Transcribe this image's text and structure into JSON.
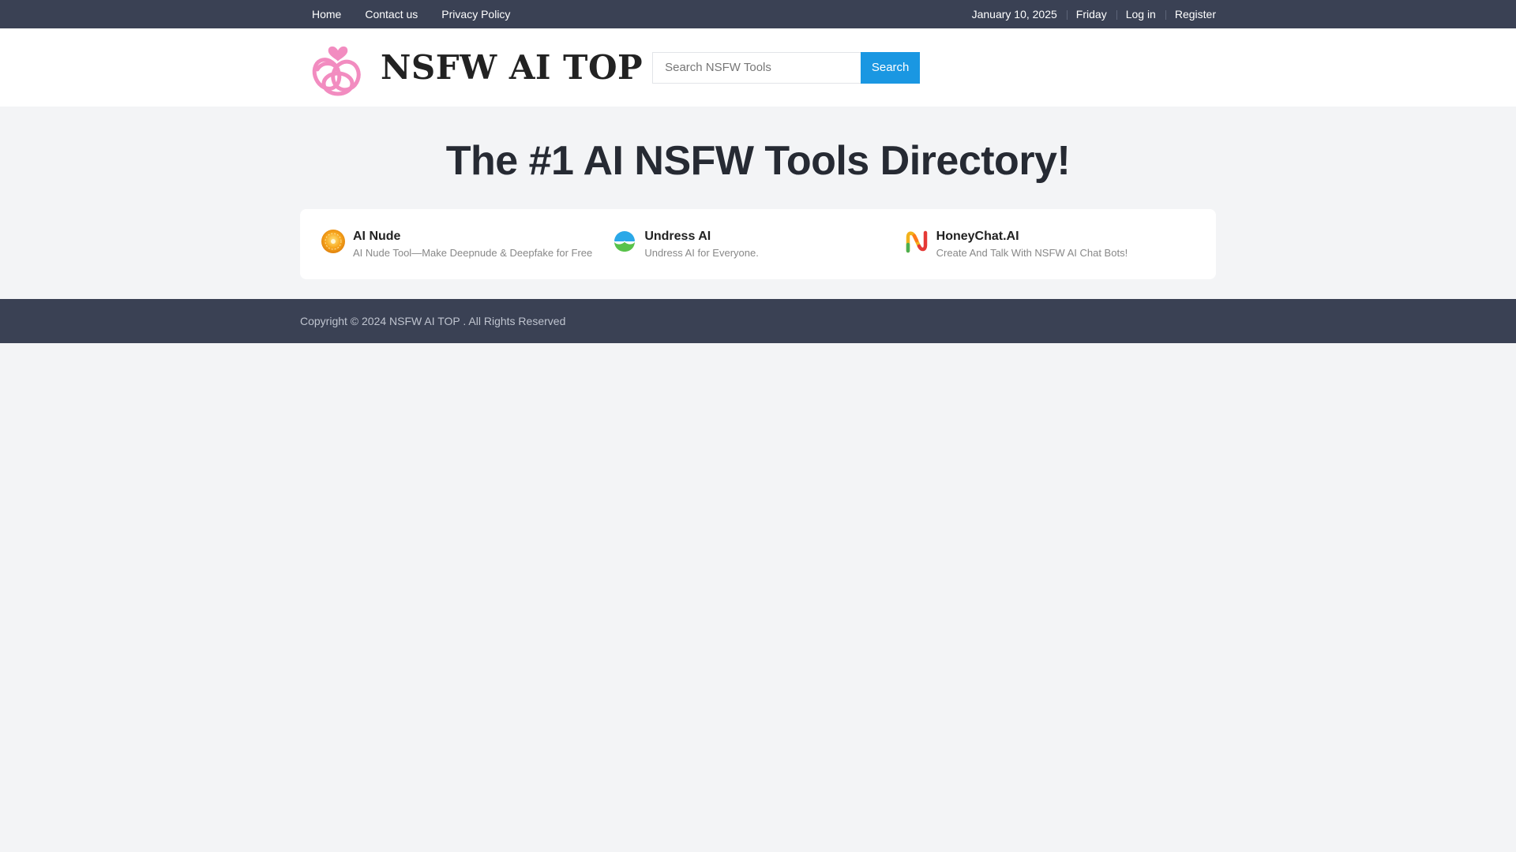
{
  "topbar": {
    "nav": [
      "Home",
      "Contact us",
      "Privacy Policy"
    ],
    "date": "January 10, 2025",
    "weekday": "Friday",
    "login": "Log in",
    "register": "Register"
  },
  "header": {
    "logo_text": "NSFW AI TOP",
    "logo_color": "#f28cc0",
    "search_placeholder": "Search NSFW Tools",
    "search_button": "Search",
    "accent": "#1a97e2"
  },
  "hero": {
    "title": "The #1 AI NSFW Tools Directory!"
  },
  "tools": [
    {
      "name": "AI Nude",
      "desc": "AI Nude Tool—Make Deepnude & Deepfake for Free",
      "icon": "orange-sun-icon"
    },
    {
      "name": "Undress AI",
      "desc": "Undress AI for Everyone.",
      "icon": "blue-green-leaf-icon"
    },
    {
      "name": "HoneyChat.AI",
      "desc": "Create And Talk With NSFW AI Chat Bots!",
      "icon": "colorful-n-icon"
    }
  ],
  "footer": {
    "copyright": "Copyright © 2024 NSFW AI TOP . All Rights Reserved"
  },
  "colors": {
    "topbar_bg": "#3a4154",
    "page_bg": "#f3f4f6"
  }
}
